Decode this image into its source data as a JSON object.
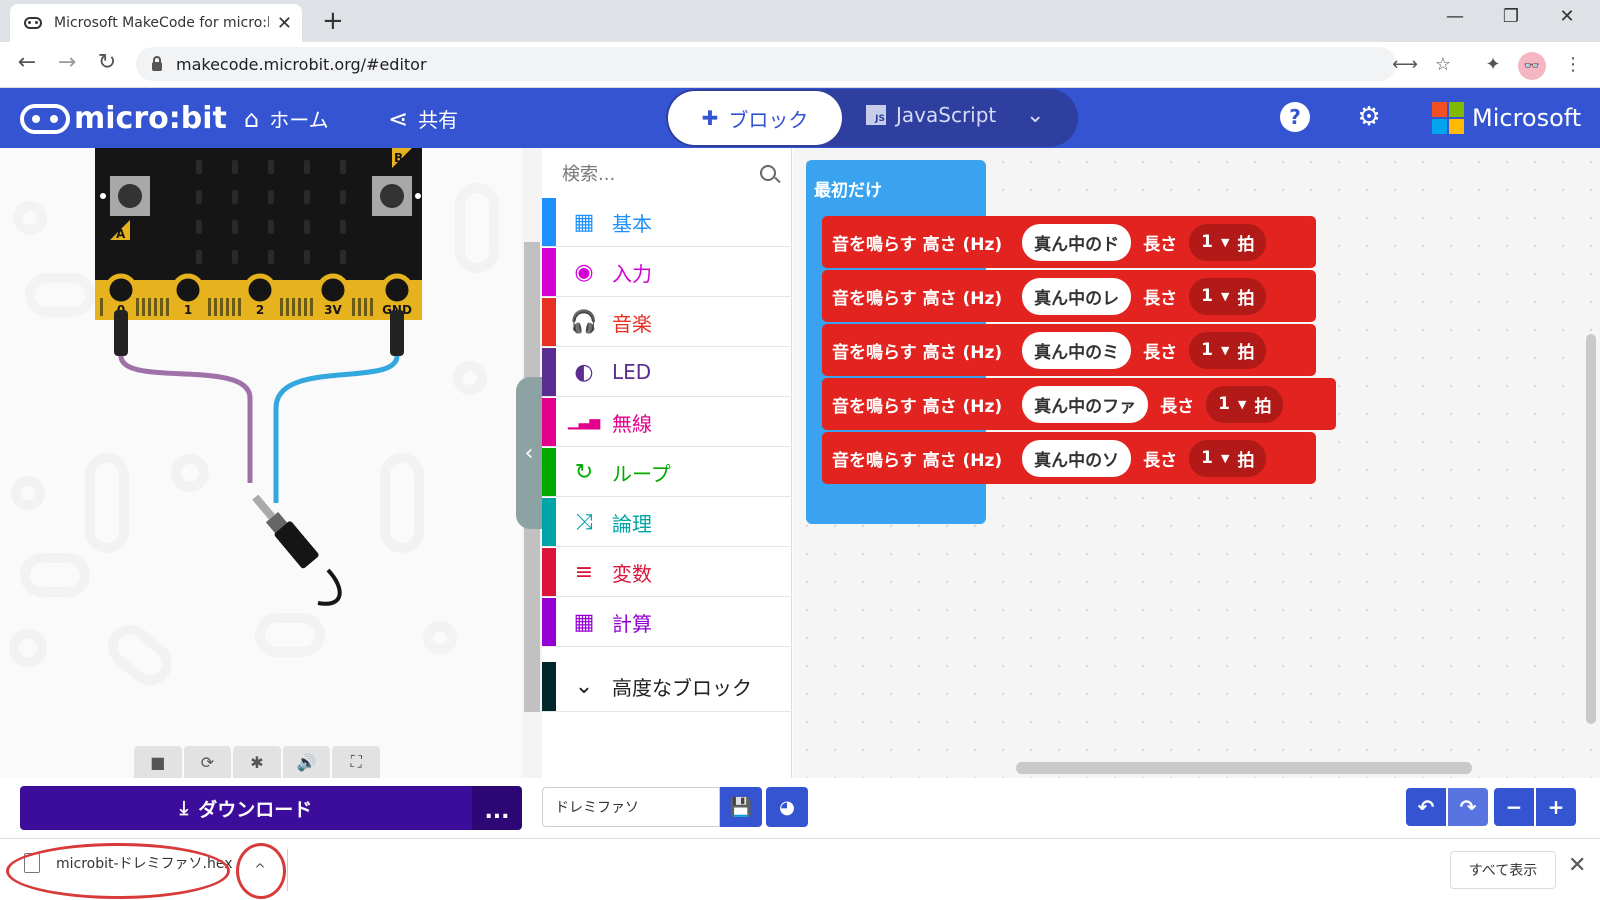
{
  "browser": {
    "tab_title": "Microsoft MakeCode for micro:bit",
    "tab_close": "✕",
    "new_tab": "+",
    "win_min": "—",
    "win_max": "❐",
    "win_close": "✕",
    "back": "←",
    "forward": "→",
    "reload": "↻",
    "url": "makecode.microbit.org/#editor",
    "translate_icon": "⟷",
    "star_icon": "☆",
    "ext_icon": "✦",
    "menu_icon": "⋮",
    "avatar": "👓"
  },
  "header": {
    "logo_text": "micro:bit",
    "home_icon": "⌂",
    "home_label": "ホーム",
    "share_icon": "⋖",
    "share_label": "共有",
    "blocks_icon": "✚",
    "blocks_label": "ブロック",
    "js_badge": "JS",
    "js_label": "JavaScript",
    "dropdown": "⌄",
    "help": "?",
    "settings": "⚙",
    "microsoft": "Microsoft",
    "ms_colors": [
      "#f25022",
      "#7fba00",
      "#00a4ef",
      "#ffb900"
    ]
  },
  "simulator": {
    "pin_labels": [
      "0",
      "1",
      "2",
      "3V",
      "GND"
    ],
    "button_a": "A",
    "button_b": "B",
    "toolbar": [
      "■",
      "⟳",
      "✱",
      "🔊",
      "⛶"
    ],
    "collapse": "‹"
  },
  "toolbox": {
    "search_placeholder": "検索...",
    "categories": [
      {
        "label": "基本",
        "icon": "▦",
        "color": "#1e90ff"
      },
      {
        "label": "入力",
        "icon": "◉",
        "color": "#d400d4"
      },
      {
        "label": "音楽",
        "icon": "🎧",
        "color": "#e63022"
      },
      {
        "label": "LED",
        "icon": "◐",
        "color": "#5c2d91"
      },
      {
        "label": "無線",
        "icon": "▁▃▅",
        "color": "#e3008c"
      },
      {
        "label": "ループ",
        "icon": "↻",
        "color": "#00aa00"
      },
      {
        "label": "論理",
        "icon": "⤨",
        "color": "#00a4a6"
      },
      {
        "label": "変数",
        "icon": "≡",
        "color": "#dc143c"
      },
      {
        "label": "計算",
        "icon": "▦",
        "color": "#9400d3"
      }
    ],
    "advanced_label": "高度なブロック",
    "advanced_icon": "⌄",
    "advanced_color": "#00272b"
  },
  "workspace": {
    "start_label": "最初だけ",
    "start_color": "#3aa3f0",
    "tone_color": "#e3231f",
    "tone_text": "音を鳴らす 高さ (Hz)",
    "length_text": "長さ",
    "beat_unit": "拍",
    "tones": [
      {
        "note": "真ん中のド",
        "beats": "1"
      },
      {
        "note": "真ん中のレ",
        "beats": "1"
      },
      {
        "note": "真ん中のミ",
        "beats": "1"
      },
      {
        "note": "真ん中のファ",
        "beats": "1"
      },
      {
        "note": "真ん中のソ",
        "beats": "1"
      }
    ]
  },
  "bottombar": {
    "download_icon": "⤓",
    "download_label": "ダウンロード",
    "more": "...",
    "project_name": "ドレミファソ",
    "save_icon": "💾",
    "github_icon": "◕",
    "undo": "↶",
    "redo": "↷",
    "zoom_out": "−",
    "zoom_in": "+"
  },
  "download_shelf": {
    "filename": "microbit-ドレミファソ.hex",
    "chevron": "^",
    "show_all": "すべて表示",
    "close": "✕"
  }
}
